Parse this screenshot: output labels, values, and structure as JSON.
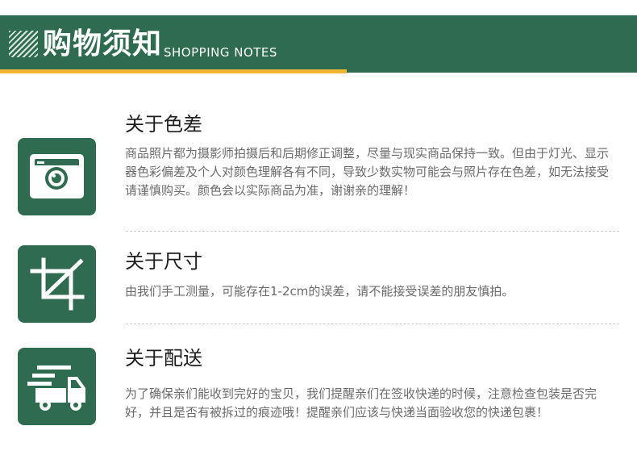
{
  "header": {
    "title": "购物须知",
    "subtitle": "SHOPPING NOTES",
    "colors": {
      "band": "#2f6b50",
      "accent": "#f2b531"
    }
  },
  "sections": [
    {
      "icon": "camera-icon",
      "title": "关于色差",
      "body": "商品照片都为摄影师拍摄后和后期修正调整，尽量与现实商品保持一致。但由于灯光、显示器色彩偏差及个人对颜色理解各有不同，导致少数实物可能会与照片存在色差，如无法接受请谨慎购买。颜色会以实际商品为准，谢谢亲的理解！"
    },
    {
      "icon": "crop-icon",
      "title": "关于尺寸",
      "body": "由我们手工测量，可能存在1-2cm的误差，请不能接受误差的朋友慎拍。"
    },
    {
      "icon": "delivery-truck-icon",
      "title": "关于配送",
      "body": "为了确保亲们能收到完好的宝贝，我们提醒亲们在签收快递的时候，注意检查包装是否完好，并且是否有被拆过的痕迹哦！提醒亲们应该与快递当面验收您的快递包裹！"
    }
  ]
}
